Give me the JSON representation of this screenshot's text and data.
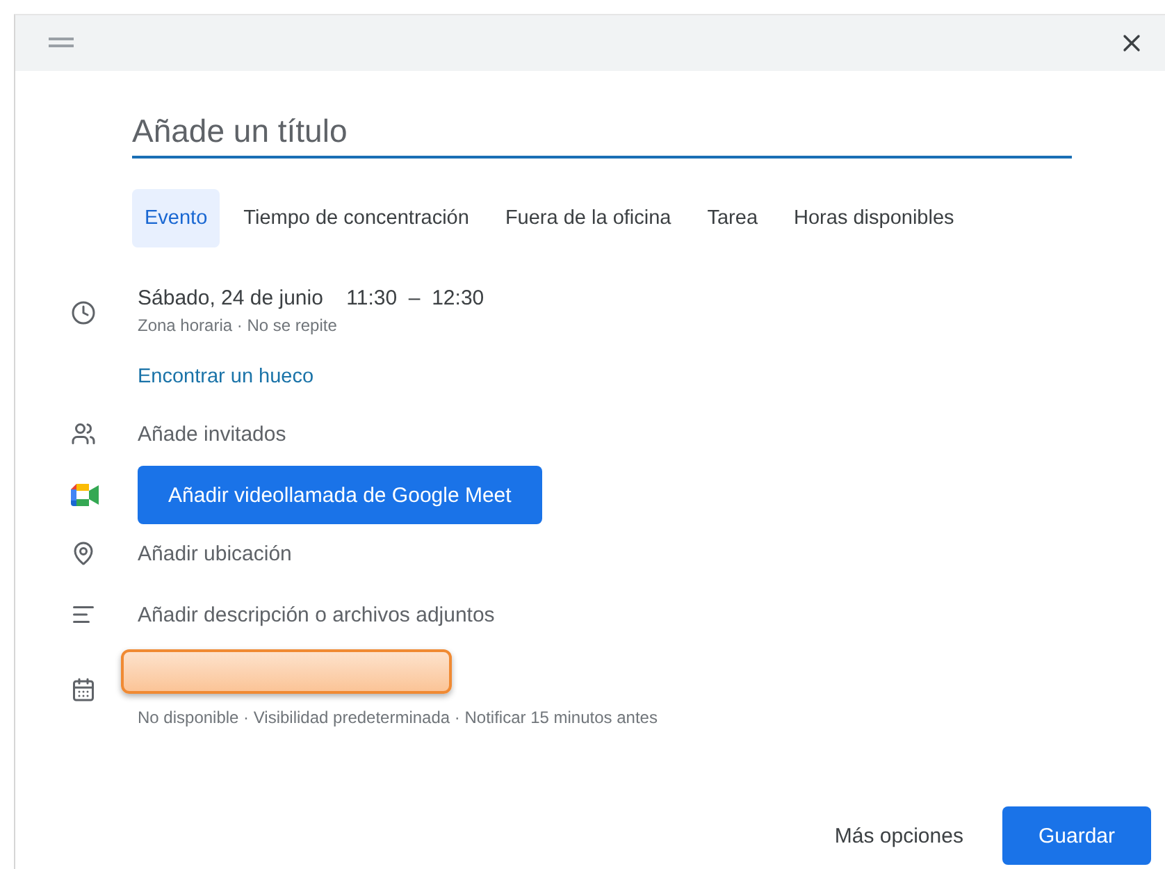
{
  "title_field": {
    "placeholder": "Añade un título"
  },
  "tabs": [
    {
      "label": "Evento",
      "selected": true
    },
    {
      "label": "Tiempo de concentración",
      "selected": false
    },
    {
      "label": "Fuera de la oficina",
      "selected": false
    },
    {
      "label": "Tarea",
      "selected": false
    },
    {
      "label": "Horas disponibles",
      "selected": false
    }
  ],
  "rows": [
    {
      "kind": "when",
      "date": "Sábado, 24 de junio",
      "start": "11:30",
      "dash": "–",
      "end": "12:30",
      "subtitle": "Zona horaria · No se repite"
    },
    {
      "kind": "link",
      "text": "Encontrar un hueco"
    },
    {
      "kind": "guests",
      "text": "Añade invitados"
    },
    {
      "kind": "meet",
      "text": "Añadir videollamada de Google Meet"
    },
    {
      "kind": "location",
      "text": "Añadir ubicación"
    },
    {
      "kind": "description",
      "text": "Añadir descripción o archivos adjuntos"
    },
    {
      "kind": "calendar",
      "redacted": true,
      "subtitle": "No disponible · Visibilidad predeterminada · Notificar 15 minutos antes"
    }
  ],
  "footer": {
    "more_options": "Más opciones",
    "save": "Guardar"
  }
}
